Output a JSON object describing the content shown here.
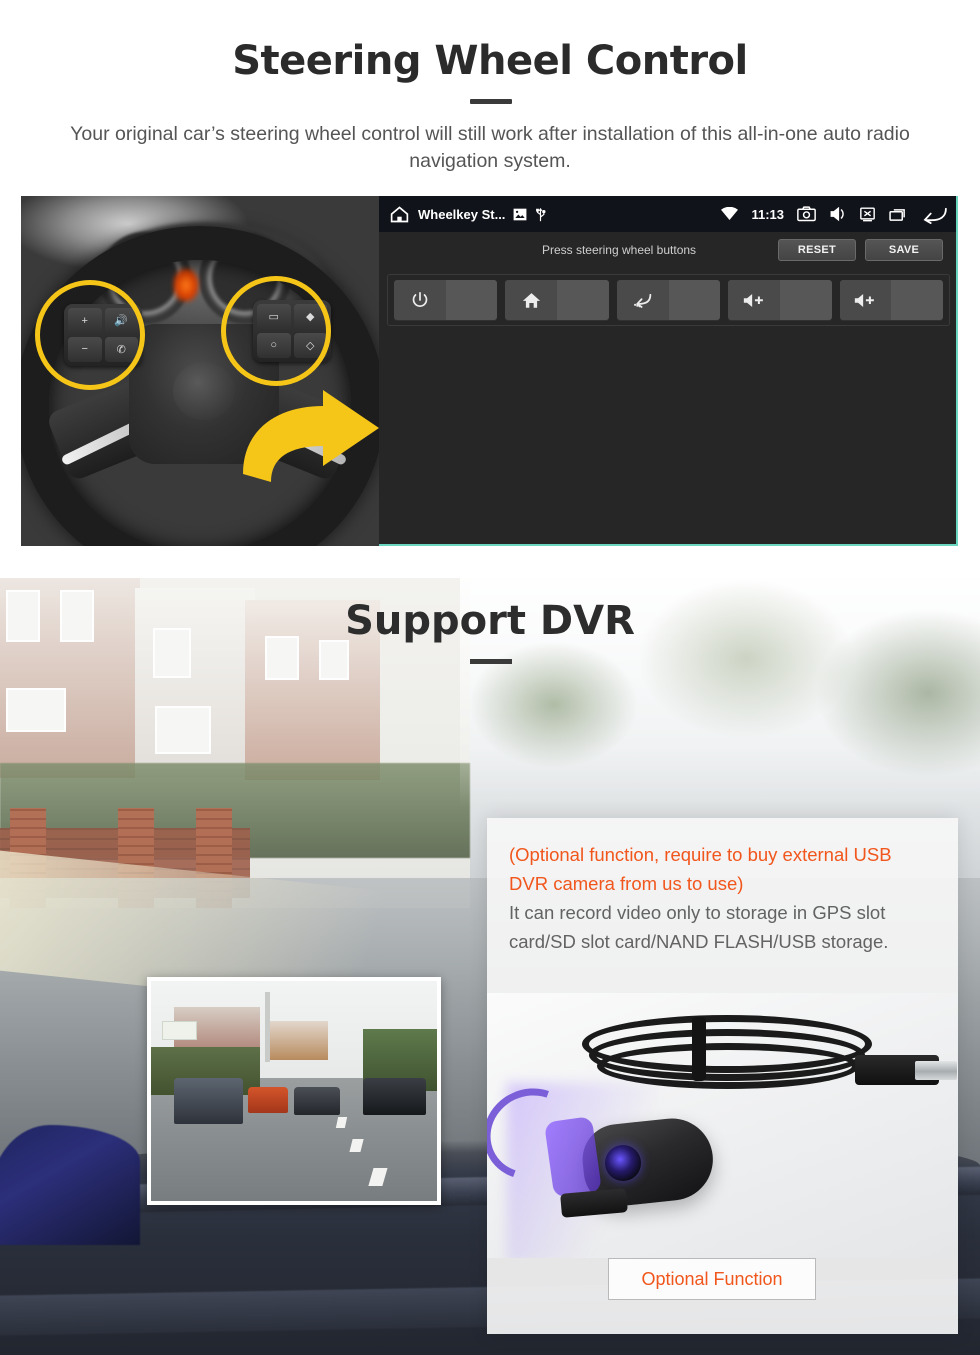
{
  "section_steering": {
    "title": "Steering Wheel Control",
    "subtitle": "Your original car’s steering wheel control will still work after installation of this all-in-one auto radio navigation system.",
    "head_unit": {
      "status_bar": {
        "home_icon": "home-icon",
        "app_title": "Wheelkey St...",
        "image_icon": "image-icon",
        "usb_icon": "usb-icon",
        "wifi_icon": "wifi-icon",
        "clock": "11:13",
        "screenshot_icon": "screenshot-icon",
        "mute_icon": "volume-mute-icon",
        "screen_off_icon": "screen-off-icon",
        "recents_icon": "recent-apps-icon",
        "back_icon": "back-arrow-icon"
      },
      "prompt": "Press steering wheel buttons",
      "reset_label": "RESET",
      "save_label": "SAVE",
      "key_slots": [
        {
          "icon": "power-icon",
          "value": ""
        },
        {
          "icon": "home-icon",
          "value": ""
        },
        {
          "icon": "back-icon",
          "value": ""
        },
        {
          "icon": "volume-up-icon",
          "value": ""
        },
        {
          "icon": "volume-up-icon",
          "value": ""
        }
      ]
    },
    "wheel_photo": {
      "left_cluster_keys": [
        "+",
        "🔊",
        "−",
        "✆"
      ],
      "right_cluster_keys": [
        "▭",
        "◆",
        "○",
        "◇"
      ],
      "highlight_color": "#f5c518",
      "arrow_color": "#f5c518"
    }
  },
  "section_dvr": {
    "title": "Support DVR",
    "notice_orange": "(Optional function, require to buy external USB DVR camera from us to use)",
    "notice_gray": "It can record video only to storage in GPS slot card/SD slot card/NAND FLASH/USB storage.",
    "button_label": "Optional Function",
    "colors": {
      "orange": "#f1561c",
      "gray_text": "#636363",
      "panel_bg": "#f6f6f6",
      "accent_teal": "#6ad6c0"
    }
  }
}
